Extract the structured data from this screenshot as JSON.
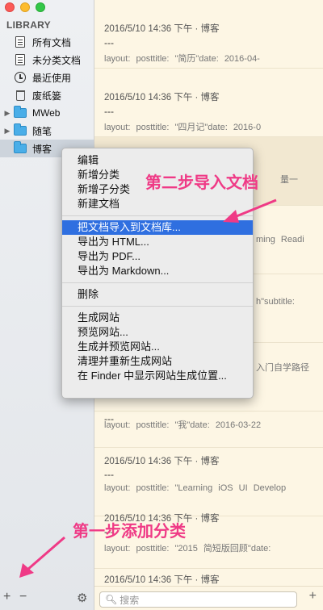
{
  "sidebar": {
    "heading": "LIBRARY",
    "items": [
      {
        "label": "所有文档",
        "icon": "document-icon"
      },
      {
        "label": "未分类文档",
        "icon": "document-icon"
      },
      {
        "label": "最近使用",
        "icon": "clock-icon"
      },
      {
        "label": "废纸篓",
        "icon": "trash-icon"
      },
      {
        "label": "MWeb",
        "icon": "folder-icon"
      },
      {
        "label": "随笔",
        "icon": "folder-icon"
      },
      {
        "label": "博客",
        "icon": "folder-icon",
        "selected": true
      }
    ],
    "add_symbol": "+",
    "remove_symbol": "−",
    "gear_symbol": "⚙"
  },
  "entries": [
    {
      "meta": "2016/5/10 14:36 下午 · 博客",
      "dash": "---",
      "body": "layout: posttitle: \"简历\"date: 2016-04-"
    },
    {
      "meta": "2016/5/10 14:36 下午 · 博客",
      "dash": "---",
      "body": "layout: posttitle: \"四月记\"date: 2016-0"
    },
    {
      "meta": "",
      "dash": "",
      "body": "量一"
    },
    {
      "meta": "",
      "dash": "",
      "body": "ming Readi"
    },
    {
      "meta": "",
      "dash": "",
      "body": "h\"subtitle:"
    },
    {
      "meta": "",
      "dash": "",
      "body": "入门自学路径"
    },
    {
      "meta": "",
      "dash": "---",
      "body": "layout: posttitle: \"我\"date: 2016-03-22"
    },
    {
      "meta": "2016/5/10 14:36 下午 · 博客",
      "dash": "---",
      "body": "layout: posttitle: \"Learning iOS UI Develop"
    },
    {
      "meta": "2016/5/10 14:36 下午 · 博客",
      "dash": "---",
      "body": "layout: posttitle: \"2015 简短版回顾\"date:"
    },
    {
      "meta": "2016/5/10 14:36 下午 · 博客",
      "dash": "",
      "body": ""
    }
  ],
  "search": {
    "placeholder": "搜索",
    "add_symbol": "+"
  },
  "menu": {
    "groups": [
      [
        "编辑",
        "新增分类",
        "新增子分类",
        "新建文档"
      ],
      [
        "把文档导入到文档库...",
        "导出为 HTML...",
        "导出为 PDF...",
        "导出为 Markdown..."
      ],
      [
        "删除"
      ],
      [
        "生成网站",
        "预览网站...",
        "生成并预览网站...",
        "清理并重新生成网站",
        "在 Finder 中显示网站生成位置..."
      ]
    ],
    "active_item": "把文档导入到文档库..."
  },
  "annotations": {
    "step2": "第二步导入文档",
    "step1": "第一步添加分类",
    "color": "#ef3a86"
  }
}
